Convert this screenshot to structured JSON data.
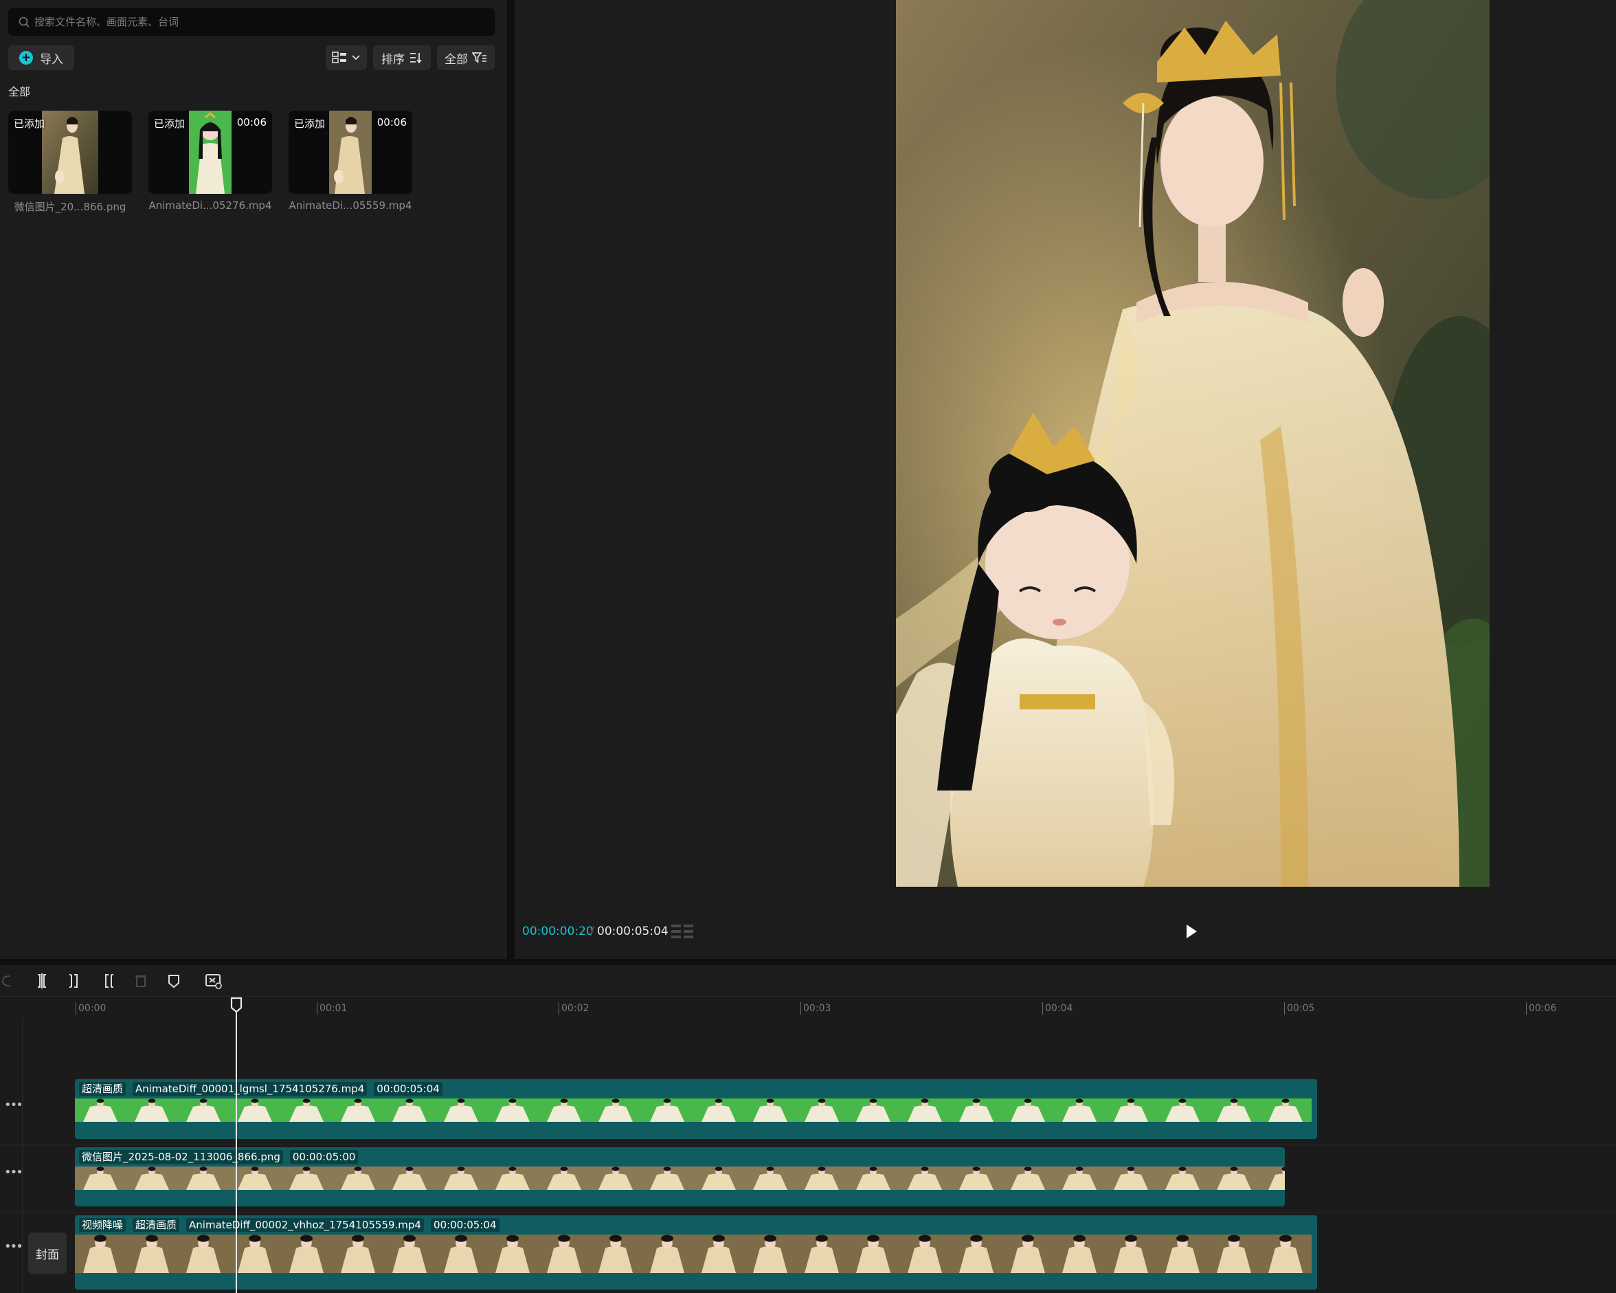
{
  "media": {
    "search_placeholder": "搜索文件名称、画面元素、台词",
    "import_label": "导入",
    "sort_label": "排序",
    "filter_label": "全部",
    "section_label": "全部",
    "items": [
      {
        "badge": "已添加",
        "duration": "",
        "name": "微信图片_20...866.png"
      },
      {
        "badge": "已添加",
        "duration": "00:06",
        "name": "AnimateDi...05276.mp4"
      },
      {
        "badge": "已添加",
        "duration": "00:06",
        "name": "AnimateDi...05559.mp4"
      }
    ]
  },
  "player": {
    "current_time": "00:00:00:20",
    "separator": "/",
    "total_time": "00:00:05:04"
  },
  "timeline": {
    "ticks": [
      "00:00",
      "00:01",
      "00:02",
      "00:03",
      "00:04",
      "00:05",
      "00:06"
    ],
    "cover_label": "封面",
    "tracks": [
      {
        "tags": [
          "超清画质",
          "AnimateDiff_00001_lgmsl_1754105276.mp4",
          "00:00:05:04"
        ]
      },
      {
        "tags": [
          "微信图片_2025-08-02_113006_866.png",
          "00:00:05:00"
        ]
      },
      {
        "tags": [
          "视频降噪",
          "超清画质",
          "AnimateDiff_00002_vhhoz_1754105559.mp4",
          "00:00:05:04"
        ]
      }
    ]
  },
  "colors": {
    "accent": "#19c3d6",
    "clip": "#0f5d61",
    "panel": "#1c1c1d",
    "greenscreen": "#49b84a"
  },
  "icons": [
    "search-icon",
    "plus-icon",
    "grid-view-icon",
    "chevron-down-icon",
    "sort-icon",
    "filter-icon",
    "play-icon",
    "split-icon",
    "trim-left-icon",
    "trim-right-icon",
    "delete-icon",
    "marker-icon",
    "auto-caption-icon",
    "undo-icon",
    "playhead-icon"
  ]
}
